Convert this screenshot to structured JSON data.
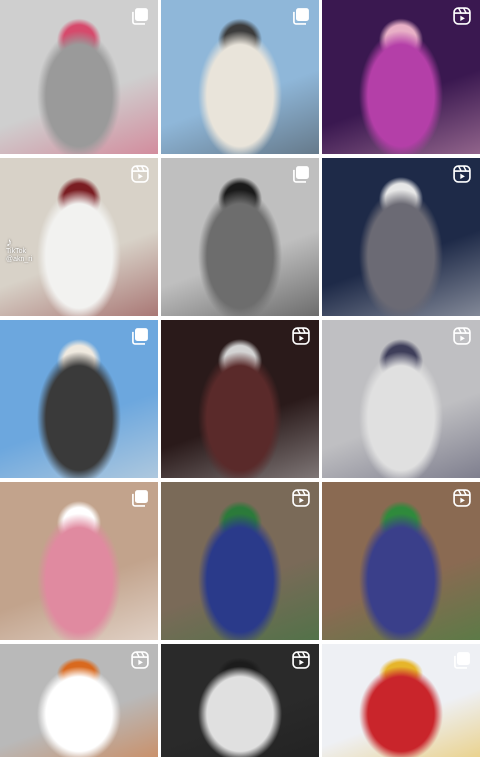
{
  "grid": {
    "tiles": [
      {
        "type": "carousel",
        "palette": [
          "#cfcfcf",
          "#9a9a9a",
          "#d64a6c"
        ]
      },
      {
        "type": "carousel",
        "palette": [
          "#8fb7d9",
          "#e9e4da",
          "#3c3c3c"
        ]
      },
      {
        "type": "reel",
        "palette": [
          "#3a1850",
          "#b43fa8",
          "#e8b0c6"
        ]
      },
      {
        "type": "reel",
        "palette": [
          "#d8d2c8",
          "#f2f2f0",
          "#7a1d22"
        ],
        "watermark": {
          "app": "TikTok",
          "handle": "@akn_ri"
        }
      },
      {
        "type": "carousel",
        "palette": [
          "#bfbfbf",
          "#6d6d6d",
          "#1a1a1a"
        ]
      },
      {
        "type": "reel",
        "palette": [
          "#1e2a48",
          "#6b6a74",
          "#e7e7e7"
        ]
      },
      {
        "type": "carousel",
        "palette": [
          "#6ca7de",
          "#3a3a3a",
          "#efe9df"
        ]
      },
      {
        "type": "reel",
        "palette": [
          "#2a1a1a",
          "#5a2a2a",
          "#d3d3d3"
        ]
      },
      {
        "type": "reel",
        "palette": [
          "#bfbfc2",
          "#e0e0e0",
          "#3e3e5a"
        ]
      },
      {
        "type": "carousel",
        "palette": [
          "#c2a38c",
          "#e08aa0",
          "#ffffff"
        ]
      },
      {
        "type": "reel",
        "palette": [
          "#7a6a58",
          "#2a3a8a",
          "#2b7a3a"
        ]
      },
      {
        "type": "reel",
        "palette": [
          "#8a6a52",
          "#3a3f8a",
          "#2f8a3c"
        ]
      },
      {
        "type": "reel",
        "palette": [
          "#b9b9b9",
          "#ffffff",
          "#d9691e"
        ]
      },
      {
        "type": "reel",
        "palette": [
          "#2a2a2a",
          "#e0e0e0",
          "#1c1c1c"
        ]
      },
      {
        "type": "carousel",
        "palette": [
          "#eef0f4",
          "#c9252b",
          "#e6b52a"
        ]
      }
    ]
  }
}
